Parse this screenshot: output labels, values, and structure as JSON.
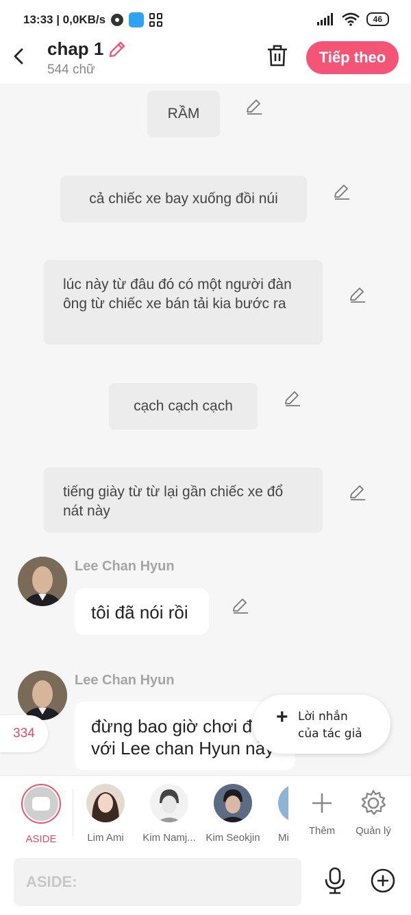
{
  "status_bar": {
    "time_speed": "13:33 | 0,0KB/s",
    "battery": "46"
  },
  "header": {
    "title": "chap 1",
    "subtitle": "544 chữ",
    "next_label": "Tiếp theo"
  },
  "narrations": [
    "RẦM",
    "cả chiếc xe bay xuống đồi núi",
    "lúc này từ đâu đó có một người đàn ông từ chiếc xe bán tải kia bước ra",
    "cạch cạch cạch",
    "tiếng giày từ từ lại gần chiếc xe đổ nát này"
  ],
  "messages": [
    {
      "name": "Lee Chan Hyun",
      "text": "tôi đã nói rồi"
    },
    {
      "name": "Lee Chan Hyun",
      "text": "đừng bao giờ chơi đ với Lee chan Hyun này"
    }
  ],
  "count_badge": "334",
  "author_note": {
    "line1": "Lời nhắn",
    "line2": "của tác giả"
  },
  "characters": [
    {
      "label": "ASIDE",
      "color": "#e04b66"
    },
    {
      "label": "Lim Ami"
    },
    {
      "label": "Kim Namj..."
    },
    {
      "label": "Kim Seokjin"
    },
    {
      "label": "Min"
    }
  ],
  "actions": {
    "add_label": "Thêm",
    "manage_label": "Quản lý"
  },
  "input": {
    "placeholder": "ASIDE:"
  },
  "colors": {
    "accent": "#f45577",
    "background": "#f6f6f6"
  }
}
